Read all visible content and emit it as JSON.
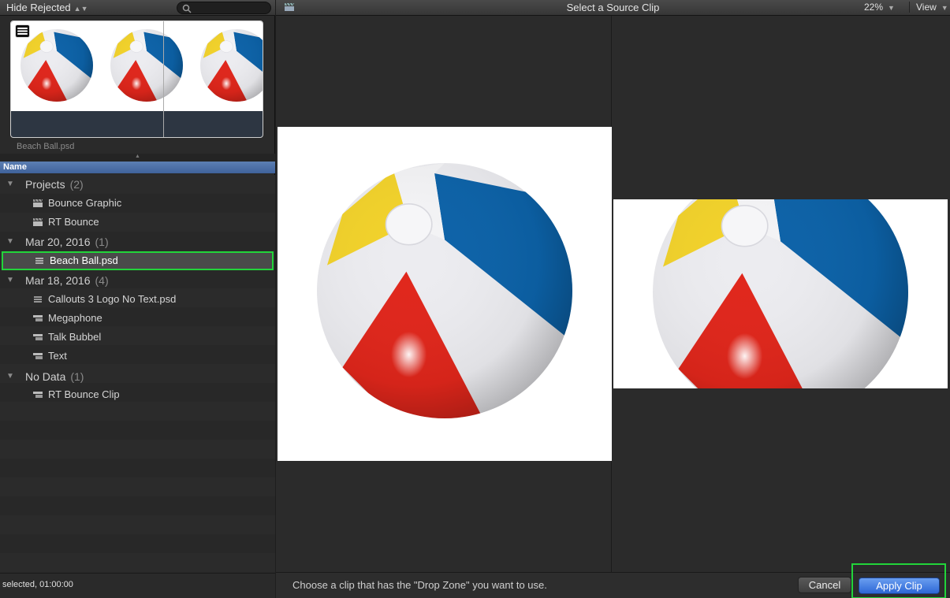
{
  "browser": {
    "filter_label": "Hide Rejected",
    "filmstrip_clip_name": "Beach Ball.psd",
    "column_header": "Name",
    "groups": [
      {
        "label": "Projects",
        "count": "(2)",
        "items": [
          "Bounce Graphic",
          "RT Bounce"
        ]
      },
      {
        "label": "Mar 20, 2016",
        "count": "(1)",
        "items": [
          "Beach Ball.psd"
        ]
      },
      {
        "label": "Mar 18, 2016",
        "count": "(4)",
        "items": [
          "Callouts 3 Logo No Text.psd",
          "Megaphone",
          "Talk Bubbel",
          "Text"
        ]
      },
      {
        "label": "No Data",
        "count": "(1)",
        "items": [
          "RT Bounce Clip"
        ]
      }
    ],
    "selected_item": "Beach Ball.psd",
    "status": "selected, 01:00:00"
  },
  "viewer": {
    "title": "Select a Source Clip",
    "zoom": "22%",
    "view_menu": "View",
    "hint": "Choose a clip that has the \"Drop Zone\" you want to use.",
    "cancel_label": "Cancel",
    "apply_label": "Apply Clip"
  },
  "colors": {
    "selection_outline": "#22d43a",
    "apply_button": "#2d67d6",
    "ball_red": "#e0261b",
    "ball_blue": "#0c62a8",
    "ball_yellow": "#f2d22a"
  }
}
